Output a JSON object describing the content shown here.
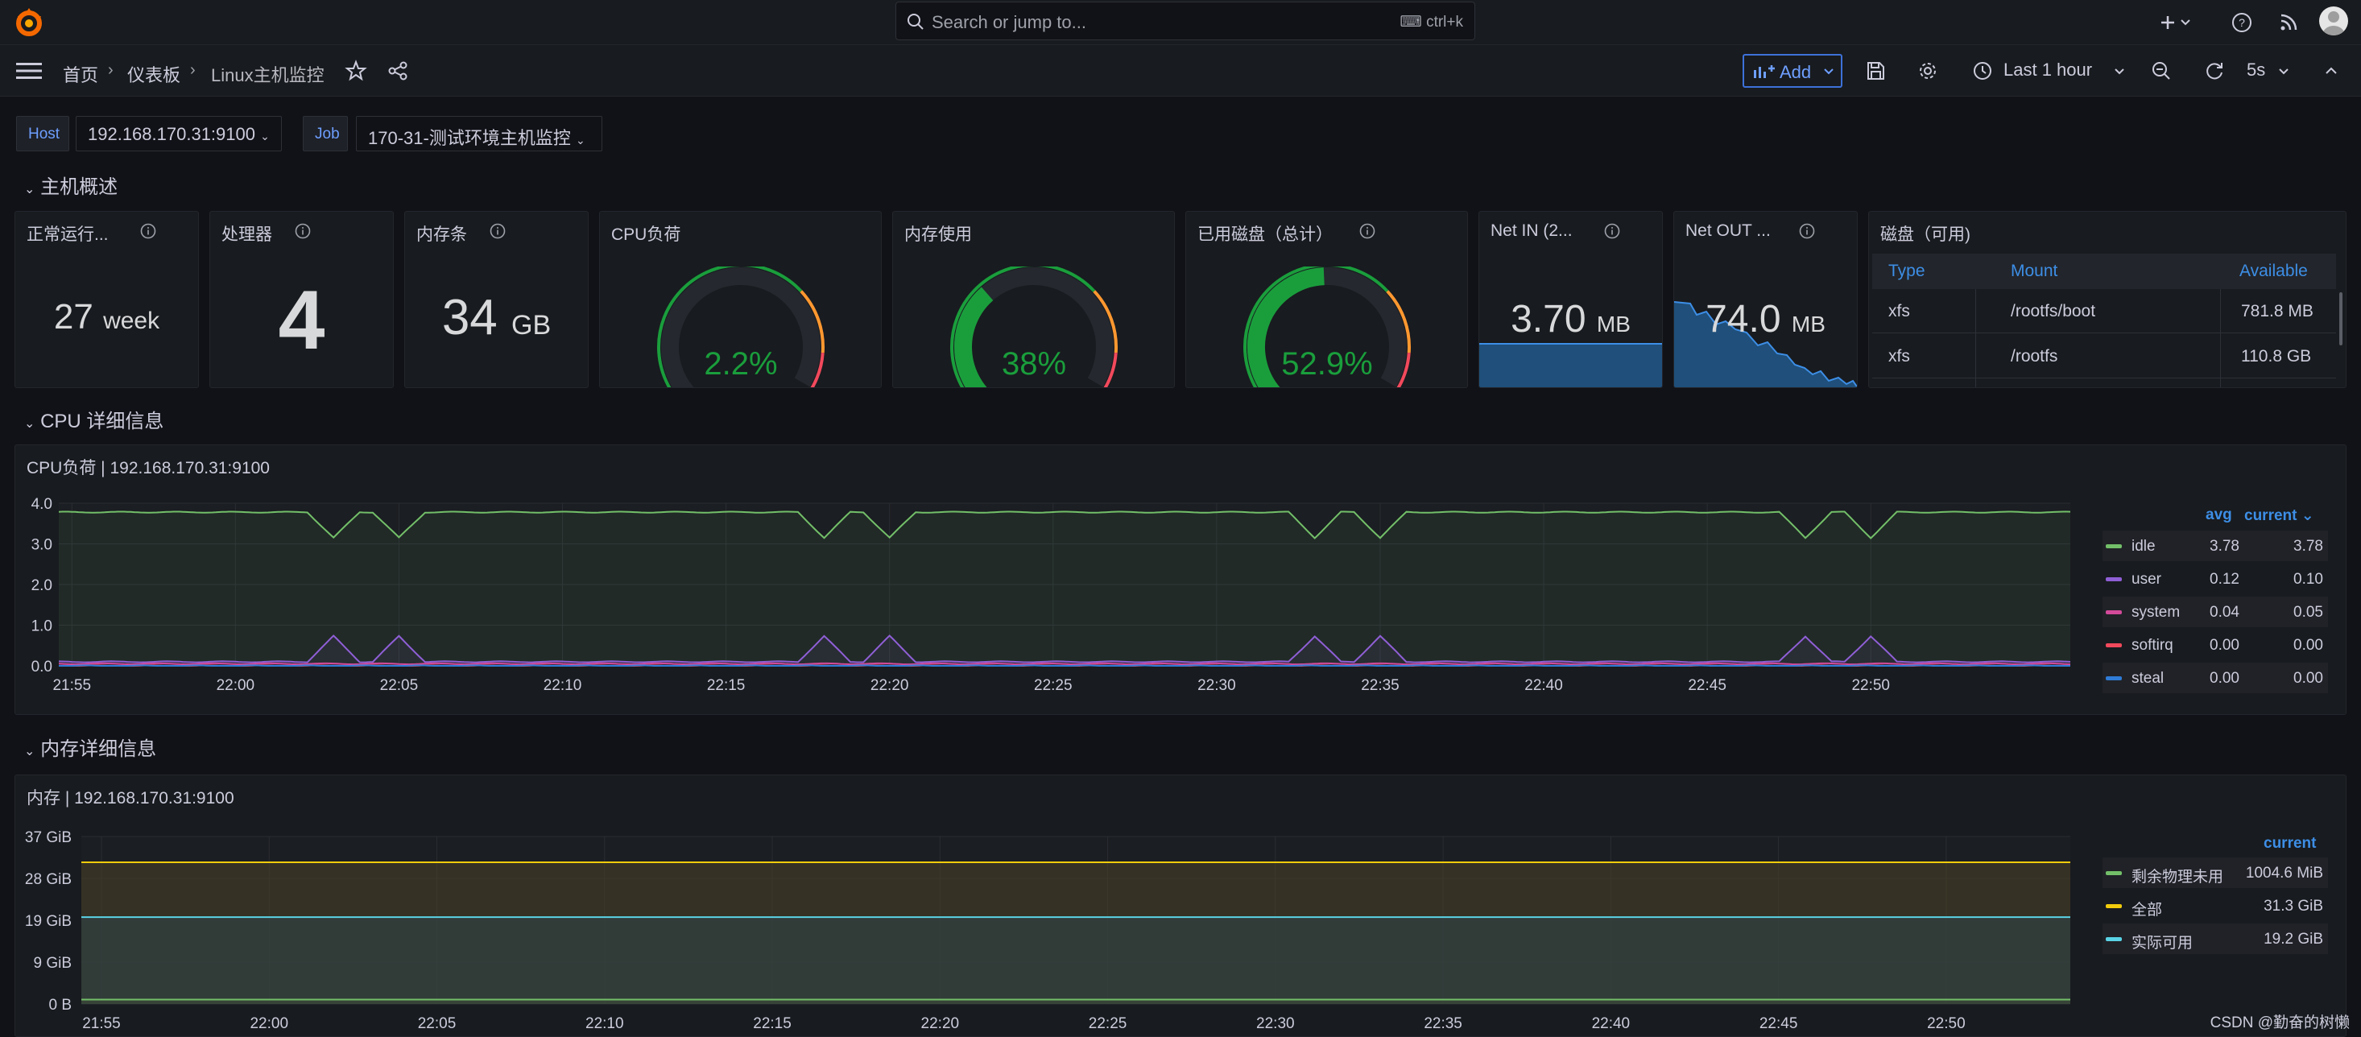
{
  "topbar": {
    "search_placeholder": "Search or jump to...",
    "search_shortcut": "ctrl+k"
  },
  "nav": {
    "breadcrumb": [
      "首页",
      "仪表板",
      "Linux主机监控"
    ],
    "add_label": "Add",
    "time_range": "Last 1 hour",
    "refresh_interval": "5s"
  },
  "variables": [
    {
      "label": "Host",
      "value": "192.168.170.31:9100"
    },
    {
      "label": "Job",
      "value": "170-31-测试环境主机监控"
    }
  ],
  "rows": {
    "overview": "主机概述",
    "cpu": "CPU 详细信息",
    "memory": "内存详细信息"
  },
  "stats": {
    "uptime": {
      "title": "正常运行...",
      "value": "27",
      "unit": "week"
    },
    "cpus": {
      "title": "处理器",
      "value": "4"
    },
    "ram": {
      "title": "内存条",
      "value": "34",
      "unit": "GB"
    },
    "cpu_load": {
      "title": "CPU负荷",
      "value": "2.2%",
      "percent": 2.2
    },
    "mem_used": {
      "title": "内存使用",
      "value": "38%",
      "percent": 38
    },
    "disk_used": {
      "title": "已用磁盘（总计）",
      "value": "52.9%",
      "percent": 52.9
    },
    "net_in": {
      "title": "Net IN (2...",
      "value": "3.70",
      "unit": "MB"
    },
    "net_out": {
      "title": "Net OUT ...",
      "value": "74.0",
      "unit": "MB"
    }
  },
  "disk_table": {
    "title": "磁盘（可用)",
    "columns": [
      "Type",
      "Mount",
      "Available"
    ],
    "rows": [
      [
        "xfs",
        "/rootfs/boot",
        "781.8 MB"
      ],
      [
        "xfs",
        "/rootfs",
        "110.8 GB"
      ]
    ]
  },
  "colors": {
    "green": "#73bf69",
    "purple": "#8f5fd6",
    "magenta": "#d44a9a",
    "red": "#f2495c",
    "blue": "#2f7bd6",
    "orange": "#ff9830",
    "yellow": "#f2cc0c",
    "cyan": "#5ad3e6",
    "gauge_green": "#1a9e3c"
  },
  "chart_data": [
    {
      "type": "line",
      "title": "CPU负荷 | 192.168.170.31:9100",
      "x": [
        "21:55",
        "22:00",
        "22:05",
        "22:10",
        "22:15",
        "22:20",
        "22:25",
        "22:30",
        "22:35",
        "22:40",
        "22:45",
        "22:50"
      ],
      "ylim": [
        0,
        4
      ],
      "yticks": [
        "0.0",
        "1.0",
        "2.0",
        "3.0",
        "4.0"
      ],
      "legend_headers": [
        "avg",
        "current"
      ],
      "series": [
        {
          "name": "idle",
          "avg": "3.78",
          "current": "3.78",
          "baseline": 3.78,
          "dip": 0.7
        },
        {
          "name": "user",
          "avg": "0.12",
          "current": "0.10",
          "baseline": 0.1,
          "dip": -0.7
        },
        {
          "name": "system",
          "avg": "0.04",
          "current": "0.05",
          "baseline": 0.05,
          "dip": 0
        },
        {
          "name": "softirq",
          "avg": "0.00",
          "current": "0.00",
          "baseline": 0,
          "dip": 0
        },
        {
          "name": "steal",
          "avg": "0.00",
          "current": "0.00",
          "baseline": 0,
          "dip": 0
        }
      ],
      "spike_times": [
        "22:03",
        "22:05",
        "22:18",
        "22:20",
        "22:33",
        "22:35",
        "22:48",
        "22:50"
      ]
    },
    {
      "type": "area",
      "title": "内存 | 192.168.170.31:9100",
      "x": [
        "21:55",
        "22:00",
        "22:05",
        "22:10",
        "22:15",
        "22:20",
        "22:25",
        "22:30",
        "22:35",
        "22:40",
        "22:45",
        "22:50"
      ],
      "ylim": [
        0,
        37
      ],
      "yticks": [
        "0 B",
        "9 GiB",
        "19 GiB",
        "28 GiB",
        "37 GiB"
      ],
      "legend_headers": [
        "current"
      ],
      "series": [
        {
          "name": "剩余物理未用",
          "current": "1004.6 MiB",
          "value_gib": 0.98
        },
        {
          "name": "全部",
          "current": "31.3 GiB",
          "value_gib": 31.3
        },
        {
          "name": "实际可用",
          "current": "19.2 GiB",
          "value_gib": 19.2
        }
      ]
    }
  ],
  "watermark": "CSDN @勤奋的树懒"
}
